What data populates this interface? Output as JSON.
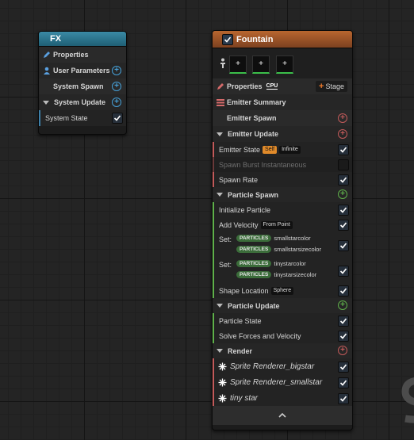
{
  "fx": {
    "title": "FX",
    "properties": "Properties",
    "user_parameters": "User Parameters",
    "system_spawn": "System Spawn",
    "system_update": "System Update",
    "system_state": "System State"
  },
  "fountain": {
    "title": "Fountain",
    "properties": "Properties",
    "cpu": "CPU",
    "stage": "Stage",
    "emitter_summary": "Emitter Summary",
    "emitter_spawn": "Emitter Spawn",
    "emitter_update": "Emitter Update",
    "emitter_state": "Emitter State",
    "emitter_state_self": "Self",
    "emitter_state_infinite": "Infinite",
    "spawn_burst": "Spawn Burst Instantaneous",
    "spawn_rate": "Spawn Rate",
    "particle_spawn": "Particle Spawn",
    "initialize_particle": "Initialize Particle",
    "add_velocity": "Add Velocity",
    "add_velocity_mode": "From Point",
    "set1_label": "Set:",
    "set1_tag1": "PARTICLES",
    "set1_val1": "smallstarcolor",
    "set1_tag2": "PARTICLES",
    "set1_val2": "smallstarsizecolor",
    "set2_label": "Set:",
    "set2_tag1": "PARTICLES",
    "set2_val1": "tinystarcolor",
    "set2_tag2": "PARTICLES",
    "set2_val2": "tinystarsizecolor",
    "shape_location": "Shape Location",
    "shape_location_mode": "Sphere",
    "particle_update": "Particle Update",
    "particle_state": "Particle State",
    "solve_forces": "Solve Forces and Velocity",
    "render": "Render",
    "renderers": [
      "Sprite Renderer_bigstar",
      "Sprite Renderer_smallstar",
      "tiny star"
    ]
  },
  "colors": {
    "fx_header": "#2a6f86",
    "fountain_header": "#9a5226",
    "checkbox_blue": "#4aa0e6",
    "plus_blue": "#46a0d8",
    "plus_green": "#5fb04a",
    "plus_red": "#c25a5a",
    "stage_orange": "#f07a2a"
  },
  "icons": {
    "fx_properties": "pencil-icon",
    "user_parameters": "user-icon",
    "fountain_properties": "pencil-icon",
    "emitter_summary": "list-icon",
    "renderer": "sprite-burst-icon",
    "collapse": "chevron-up-icon"
  }
}
